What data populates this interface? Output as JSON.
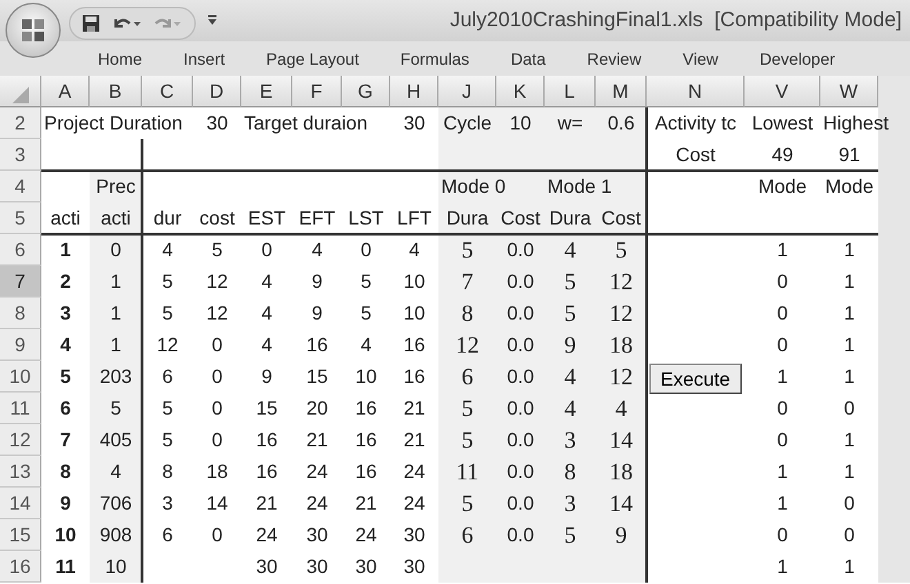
{
  "window": {
    "title": "July2010CrashingFinal1.xls  [Compatibility Mode]"
  },
  "ribbon_tabs": [
    {
      "label": "Home",
      "selected": false
    },
    {
      "label": "Insert",
      "selected": false
    },
    {
      "label": "Page Layout",
      "selected": false
    },
    {
      "label": "Formulas",
      "selected": false
    },
    {
      "label": "Data",
      "selected": false
    },
    {
      "label": "Review",
      "selected": false
    },
    {
      "label": "View",
      "selected": false
    },
    {
      "label": "Developer",
      "selected": false
    }
  ],
  "columns": [
    "A",
    "B",
    "C",
    "D",
    "E",
    "F",
    "G",
    "H",
    "J",
    "K",
    "L",
    "M",
    "N",
    "V",
    "W"
  ],
  "rows": [
    {
      "num": "2",
      "selected": false,
      "kind": "header",
      "cells": [
        "Project Duration",
        null,
        null,
        "30",
        "Target duraion",
        null,
        null,
        "30",
        "Cycle",
        "10",
        "w=",
        "0.6",
        "Activity tc",
        "Lowest",
        "Highest"
      ]
    },
    {
      "num": "3",
      "selected": false,
      "kind": "header",
      "cells": [
        null,
        null,
        null,
        null,
        null,
        null,
        null,
        null,
        null,
        null,
        null,
        null,
        "Cost",
        "49",
        "91"
      ]
    },
    {
      "num": "4",
      "selected": false,
      "kind": "header",
      "cells": [
        null,
        "Prec",
        null,
        null,
        null,
        null,
        null,
        null,
        "Mode 0",
        null,
        "Mode 1",
        null,
        null,
        "Mode",
        "Mode"
      ]
    },
    {
      "num": "5",
      "selected": false,
      "kind": "header",
      "cells": [
        "acti",
        "acti",
        "dur",
        "cost",
        "EST",
        "EFT",
        "LST",
        "LFT",
        "Dura",
        "Cost",
        "Dura",
        "Cost",
        null,
        null,
        null
      ]
    },
    {
      "num": "6",
      "selected": false,
      "kind": "activity",
      "cells": [
        "1",
        "0",
        "4",
        "5",
        "0",
        "4",
        "0",
        "4",
        "5",
        "0.0",
        "4",
        "5",
        null,
        "1",
        "1"
      ]
    },
    {
      "num": "7",
      "selected": true,
      "kind": "activity",
      "cells": [
        "2",
        "1",
        "5",
        "12",
        "4",
        "9",
        "5",
        "10",
        "7",
        "0.0",
        "5",
        "12",
        null,
        "0",
        "1"
      ]
    },
    {
      "num": "8",
      "selected": false,
      "kind": "activity",
      "cells": [
        "3",
        "1",
        "5",
        "12",
        "4",
        "9",
        "5",
        "10",
        "8",
        "0.0",
        "5",
        "12",
        null,
        "0",
        "1"
      ]
    },
    {
      "num": "9",
      "selected": false,
      "kind": "activity",
      "cells": [
        "4",
        "1",
        "12",
        "0",
        "4",
        "16",
        "4",
        "16",
        "12",
        "0.0",
        "9",
        "18",
        null,
        "0",
        "1"
      ]
    },
    {
      "num": "10",
      "selected": false,
      "kind": "activity",
      "button": "Execute",
      "cells": [
        "5",
        "203",
        "6",
        "0",
        "9",
        "15",
        "10",
        "16",
        "6",
        "0.0",
        "4",
        "12",
        null,
        "1",
        "1"
      ]
    },
    {
      "num": "11",
      "selected": false,
      "kind": "activity",
      "cells": [
        "6",
        "5",
        "5",
        "0",
        "15",
        "20",
        "16",
        "21",
        "5",
        "0.0",
        "4",
        "4",
        null,
        "0",
        "0"
      ]
    },
    {
      "num": "12",
      "selected": false,
      "kind": "activity",
      "cells": [
        "7",
        "405",
        "5",
        "0",
        "16",
        "21",
        "16",
        "21",
        "5",
        "0.0",
        "3",
        "14",
        null,
        "0",
        "1"
      ]
    },
    {
      "num": "13",
      "selected": false,
      "kind": "activity",
      "cells": [
        "8",
        "4",
        "8",
        "18",
        "16",
        "24",
        "16",
        "24",
        "11",
        "0.0",
        "8",
        "18",
        null,
        "1",
        "1"
      ]
    },
    {
      "num": "14",
      "selected": false,
      "kind": "activity",
      "cells": [
        "9",
        "706",
        "3",
        "14",
        "21",
        "24",
        "21",
        "24",
        "5",
        "0.0",
        "3",
        "14",
        null,
        "1",
        "0"
      ]
    },
    {
      "num": "15",
      "selected": false,
      "kind": "activity",
      "cells": [
        "10",
        "908",
        "6",
        "0",
        "24",
        "30",
        "24",
        "30",
        "6",
        "0.0",
        "5",
        "9",
        null,
        "0",
        "0"
      ]
    },
    {
      "num": "16",
      "selected": false,
      "kind": "activity",
      "cells": [
        "11",
        "10",
        null,
        null,
        "30",
        "30",
        "30",
        "30",
        null,
        null,
        null,
        null,
        null,
        "1",
        "1"
      ]
    }
  ]
}
